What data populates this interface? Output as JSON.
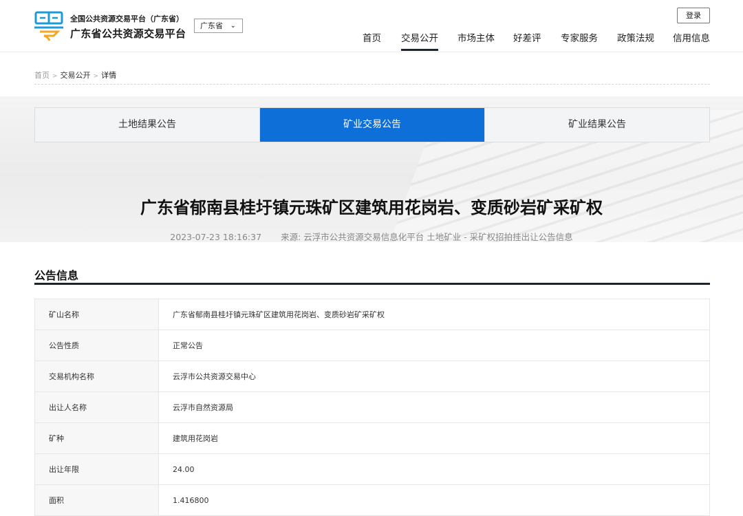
{
  "header": {
    "brand_sub": "全国公共资源交易平台（广东省）",
    "brand_main": "广东省公共资源交易平台",
    "region": "广东省",
    "login": "登录",
    "nav": [
      "首页",
      "交易公开",
      "市场主体",
      "好差评",
      "专家服务",
      "政策法规",
      "信用信息"
    ],
    "active_nav": "交易公开",
    "logo_char": "粤",
    "logo_color": "#1d9bd7"
  },
  "breadcrumb": [
    "首页",
    "交易公开",
    "详情"
  ],
  "tabs": [
    "土地结果公告",
    "矿业交易公告",
    "矿业结果公告"
  ],
  "active_tab": "矿业交易公告",
  "article": {
    "title": "广东省郁南县桂圩镇元珠矿区建筑用花岗岩、变质砂岩矿采矿权",
    "datetime": "2023-07-23 18:16:37",
    "source": "来源: 云浮市公共资源交易信息化平台 土地矿业 - 采矿权招拍挂出让公告信息"
  },
  "section": {
    "title": "公告信息"
  },
  "rows": [
    {
      "label": "矿山名称",
      "value": "广东省郁南县桂圩镇元珠矿区建筑用花岗岩、变质砂岩矿采矿权"
    },
    {
      "label": "公告性质",
      "value": "正常公告"
    },
    {
      "label": "交易机构名称",
      "value": "云浮市公共资源交易中心"
    },
    {
      "label": "出让人名称",
      "value": "云浮市自然资源局"
    },
    {
      "label": "矿种",
      "value": "建筑用花岗岩"
    },
    {
      "label": "出让年限",
      "value": "24.00"
    },
    {
      "label": "面积",
      "value": "1.416800"
    }
  ],
  "colors": {
    "primary": "#0f6fd8",
    "dark_bar": "#1a2533"
  }
}
